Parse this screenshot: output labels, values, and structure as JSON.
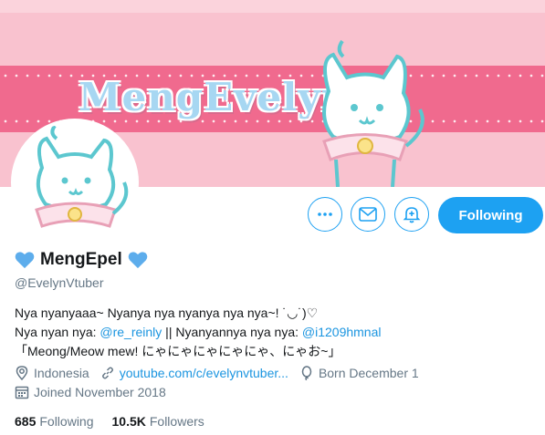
{
  "banner": {
    "logo_text": "MengEvelyn"
  },
  "actions": {
    "follow_label": "Following"
  },
  "profile": {
    "display_name": "MengEpel",
    "handle": "@EvelynVtuber",
    "bio": {
      "line1": "Nya nyanyaaa~ Nyanya nya nyanya nya nya~! ˙◡˙)♡",
      "line2_prefix": "Nya nyan nya: ",
      "line2_link1": "@re_reinly",
      "line2_mid": " || Nyanyannya nya nya: ",
      "line2_link2": "@i1209hmnal",
      "line3": "「Meong/Meow mew! にゃにゃにゃにゃにゃ、にゃお~」"
    },
    "location": "Indonesia",
    "website": "youtube.com/c/evelynvtuber...",
    "born": "Born December 1",
    "joined": "Joined November 2018"
  },
  "stats": {
    "following_count": "685",
    "following_label": "Following",
    "followers_count": "10.5K",
    "followers_label": "Followers"
  },
  "colors": {
    "accent": "#1da1f2",
    "banner_pink": "#f9c2cf",
    "stripe_pink": "#f06a8e"
  }
}
